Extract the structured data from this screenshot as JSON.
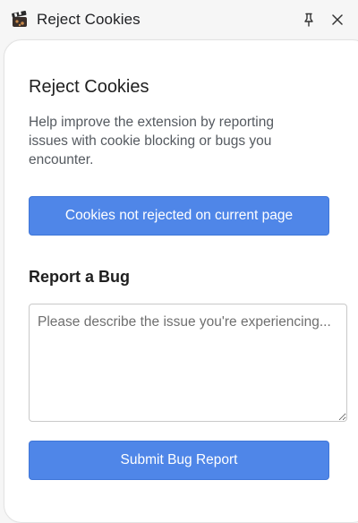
{
  "window": {
    "title": "Reject Cookies",
    "icon": "cookie-clapper-icon"
  },
  "titlebar_controls": {
    "pin_icon": "pin-icon",
    "close_icon": "close-icon"
  },
  "main": {
    "heading": "Reject Cookies",
    "description": "Help improve the extension by reporting issues with cookie blocking or bugs you encounter.",
    "cookies_button_label": "Cookies not rejected on current page",
    "bug_section_heading": "Report a Bug",
    "bug_textarea": {
      "value": "",
      "placeholder": "Please describe the issue you're experiencing..."
    },
    "submit_button_label": "Submit Bug Report"
  },
  "colors": {
    "accent": "#4f86e8",
    "background": "#f6f6f6",
    "panel": "#ffffff"
  }
}
